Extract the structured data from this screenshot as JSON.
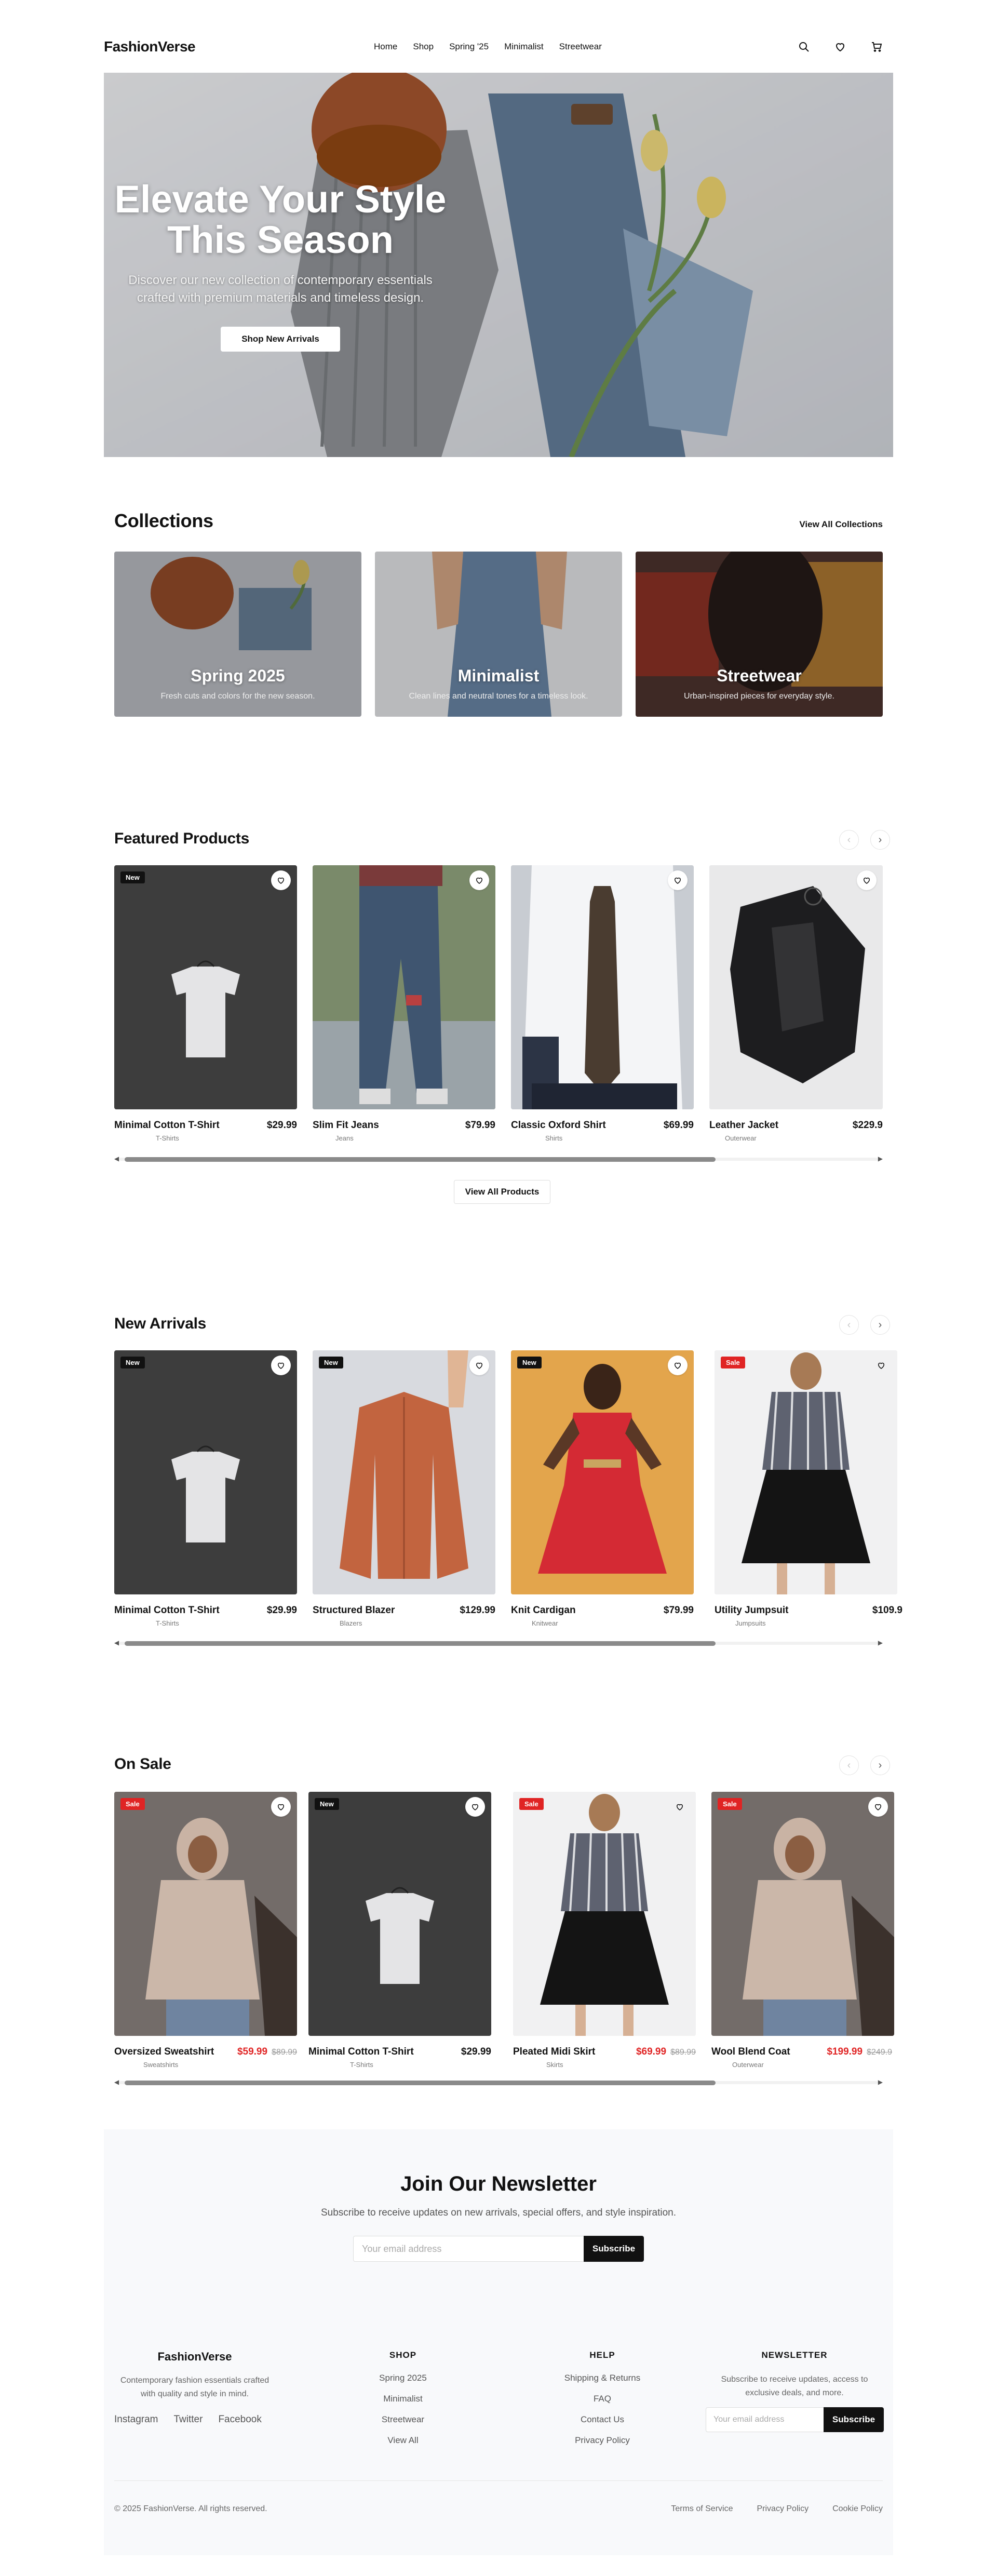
{
  "brand": "FashionVerse",
  "nav": [
    "Home",
    "Shop",
    "Spring '25",
    "Minimalist",
    "Streetwear"
  ],
  "header_icons": [
    "search-icon",
    "heart-icon",
    "cart-icon"
  ],
  "hero": {
    "title_line1": "Elevate Your Style",
    "title_line2": "This Season",
    "subtitle_line1": "Discover our new collection of contemporary essentials",
    "subtitle_line2": "crafted with premium materials and timeless design.",
    "cta": "Shop New Arrivals"
  },
  "collections": {
    "title": "Collections",
    "view_all": "View All Collections",
    "items": [
      {
        "name": "Spring 2025",
        "desc": "Fresh cuts and colors for the new season."
      },
      {
        "name": "Minimalist",
        "desc": "Clean lines and neutral tones for a timeless look."
      },
      {
        "name": "Streetwear",
        "desc": "Urban-inspired pieces for everyday style."
      }
    ]
  },
  "featured": {
    "title": "Featured Products",
    "view_all": "View All Products",
    "products": [
      {
        "name": "Minimal Cotton T-Shirt",
        "category": "T-Shirts",
        "price": "$29.99",
        "badge": "New"
      },
      {
        "name": "Slim Fit Jeans",
        "category": "Jeans",
        "price": "$79.99",
        "badge": ""
      },
      {
        "name": "Classic Oxford Shirt",
        "category": "Shirts",
        "price": "$69.99",
        "badge": ""
      },
      {
        "name": "Leather Jacket",
        "category": "Outerwear",
        "price": "$229.9",
        "badge": ""
      }
    ]
  },
  "new_arrivals": {
    "title": "New Arrivals",
    "products": [
      {
        "name": "Minimal Cotton T-Shirt",
        "category": "T-Shirts",
        "price": "$29.99",
        "badge": "New"
      },
      {
        "name": "Structured Blazer",
        "category": "Blazers",
        "price": "$129.99",
        "badge": "New"
      },
      {
        "name": "Knit Cardigan",
        "category": "Knitwear",
        "price": "$79.99",
        "badge": "New"
      },
      {
        "name": "Utility Jumpsuit",
        "category": "Jumpsuits",
        "price": "$109.9",
        "badge": "Sale"
      }
    ]
  },
  "on_sale": {
    "title": "On Sale",
    "products": [
      {
        "name": "Oversized Sweatshirt",
        "category": "Sweatshirts",
        "price": "$59.99",
        "old_price": "$89.99",
        "badge": "Sale"
      },
      {
        "name": "Minimal Cotton T-Shirt",
        "category": "T-Shirts",
        "price": "$29.99",
        "old_price": "",
        "badge": "New"
      },
      {
        "name": "Pleated Midi Skirt",
        "category": "Skirts",
        "price": "$69.99",
        "old_price": "$89.99",
        "badge": "Sale"
      },
      {
        "name": "Wool Blend Coat",
        "category": "Outerwear",
        "price": "$199.99",
        "old_price": "$249.9",
        "badge": "Sale"
      }
    ]
  },
  "newsletter": {
    "title": "Join Our Newsletter",
    "subtitle": "Subscribe to receive updates on new arrivals, special offers, and style inspiration.",
    "placeholder": "Your email address",
    "button": "Subscribe"
  },
  "footer": {
    "brand": "FashionVerse",
    "tagline_line1": "Contemporary fashion essentials crafted",
    "tagline_line2": "with quality and style in mind.",
    "social": [
      "Instagram",
      "Twitter",
      "Facebook"
    ],
    "shop_title": "SHOP",
    "shop_links": [
      "Spring 2025",
      "Minimalist",
      "Streetwear",
      "View All"
    ],
    "help_title": "HELP",
    "help_links": [
      "Shipping & Returns",
      "FAQ",
      "Contact Us",
      "Privacy Policy"
    ],
    "news_title": "NEWSLETTER",
    "news_text_line1": "Subscribe to receive updates, access to",
    "news_text_line2": "exclusive deals, and more.",
    "news_placeholder": "Your email address",
    "news_button": "Subscribe",
    "copyright": "© 2025 FashionVerse. All rights reserved.",
    "legal": [
      "Terms of Service",
      "Privacy Policy",
      "Cookie Policy"
    ]
  },
  "colors": {
    "accent": "#111111",
    "sale": "#e02424",
    "band": "#f8f9fb"
  }
}
